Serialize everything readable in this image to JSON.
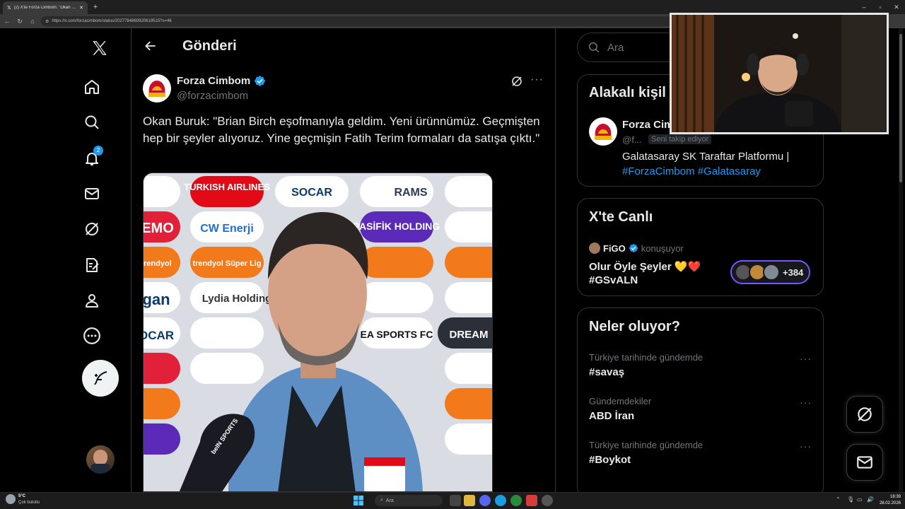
{
  "browser": {
    "tab_title": "(2) X'te Forza Cimbom: \"Okan Buru",
    "url": "https://x.com/forzacimbom/status/2027784860920619515?s=46",
    "colors": {
      "chrome": "#1f1f1f",
      "toolbar": "#3a3a3a"
    }
  },
  "header": {
    "title": "Gönderi"
  },
  "nav": {
    "items": [
      "x-logo-icon",
      "home-icon",
      "search-icon",
      "bell-icon",
      "mail-icon",
      "grok-icon",
      "notes-icon",
      "profile-icon",
      "more-icon"
    ],
    "notification_count": "2"
  },
  "post": {
    "author_name": "Forza Cimbom",
    "author_handle": "@forzacimbom",
    "verified": true,
    "text": "Okan Buruk: \"Brian Birch eşofmanıyla geldim. Yeni ürünnümüz. Geçmişten hep bir şeyler alıyoruz. Yine geçmişin Fatih Terim formaları da satışa çıktı.\"",
    "media": {
      "sponsors": [
        "TURKISH AIRLINES",
        "SOCAR",
        "RAMS",
        "EMO",
        "CW Enerji",
        "PASİFİK HOLDING",
        "trendyol",
        "trendyol Süper Lig",
        "gan",
        "Lydia Holding",
        "OCAR",
        "EA SPORTS FC",
        "DREAM"
      ],
      "mic_label": "beIN SPORTS"
    }
  },
  "search": {
    "placeholder": "Ara"
  },
  "related": {
    "title": "Alakalı kişil",
    "person_name": "Forza Cim",
    "person_handle": "@f...",
    "follows_you": "Seni takip ediyor",
    "bio": "Galatasaray SK Taraftar Platformu |",
    "bio_tags": "#ForzaCimbom #Galatasaray"
  },
  "live": {
    "title": "X'te Canlı",
    "host": "FiGO",
    "status": "konuşuyor",
    "space_title": "Olur Öyle Şeyler 💛❤️",
    "space_tag": "#GSvALN",
    "listener_count": "+384"
  },
  "trends": {
    "title": "Neler oluyor?",
    "items": [
      {
        "meta": "Türkiye tarihinde gündemde",
        "name": "#savaş"
      },
      {
        "meta": "Gündemdekiler",
        "name": "ABD İran"
      },
      {
        "meta": "Türkiye tarihinde gündemde",
        "name": "#Boykot"
      }
    ]
  },
  "taskbar": {
    "weather_temp": "5°C",
    "weather_desc": "Çok bulutlu",
    "search_label": "Ara",
    "time": "18:39",
    "date": "28.02.2026"
  }
}
